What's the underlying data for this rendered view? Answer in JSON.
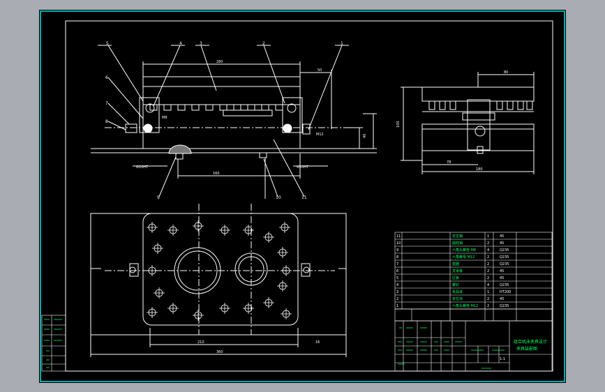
{
  "drawing": {
    "balloons": [
      "5",
      "4",
      "3",
      "2",
      "1",
      "6",
      "7",
      "8",
      "9",
      "10",
      "11"
    ],
    "title_block": {
      "drawing_title": [
        "组合机床夹具设计",
        "夹具装配图"
      ],
      "scale": "1:1"
    },
    "bom_rows": [
      {
        "no": "11",
        "name": "定位销",
        "qty": "1",
        "material": "45"
      },
      {
        "no": "10",
        "name": "圆柱销",
        "qty": "2",
        "material": "45"
      },
      {
        "no": "9",
        "name": "六角头螺栓 M8",
        "qty": "4",
        "material": "Q235"
      },
      {
        "no": "8",
        "name": "六角螺母 M12",
        "qty": "2",
        "material": "Q235"
      },
      {
        "no": "7",
        "name": "垫圈",
        "qty": "2",
        "material": "Q235"
      },
      {
        "no": "6",
        "name": "支承板",
        "qty": "2",
        "material": "45"
      },
      {
        "no": "5",
        "name": "压板",
        "qty": "2",
        "material": "45"
      },
      {
        "no": "4",
        "name": "螺钉",
        "qty": "4",
        "material": "Q235"
      },
      {
        "no": "3",
        "name": "夹具体",
        "qty": "1",
        "material": "HT200"
      },
      {
        "no": "2",
        "name": "定位块",
        "qty": "2",
        "material": "45"
      },
      {
        "no": "1",
        "name": "六角头螺栓 M12",
        "qty": "2",
        "material": "Q235"
      }
    ]
  },
  "colors": {
    "frame": "#00e5e5",
    "geometry": "#ffffff",
    "text": "#ffffff",
    "accent": "#00ff66"
  }
}
